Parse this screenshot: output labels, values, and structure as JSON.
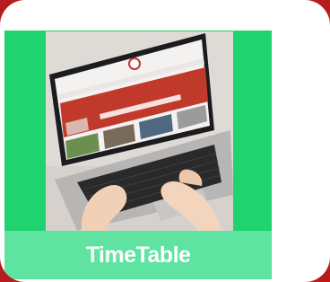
{
  "tile": {
    "label": "TimeTable",
    "colors": {
      "background_red": "#b71c1c",
      "card_white": "#ffffff",
      "panel_green": "#1fd36f",
      "label_bar_green": "#5ee3a0",
      "label_text": "#ffffff"
    },
    "image": {
      "description_icon": "laptop-photo"
    }
  }
}
